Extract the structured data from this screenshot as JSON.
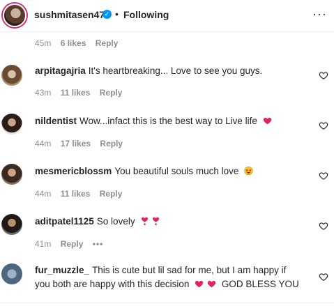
{
  "header": {
    "username": "sushmitasen47",
    "separator": "•",
    "follow_status": "Following",
    "more_label": "···"
  },
  "top_meta": {
    "time": "45m",
    "likes": "6 likes",
    "reply": "Reply"
  },
  "comments": [
    {
      "user": "arpitagajria",
      "text": "It's heartbreaking... Love to see you guys.",
      "time": "43m",
      "likes": "11 likes",
      "reply": "Reply",
      "emoji": []
    },
    {
      "user": "nildentist",
      "text": "Wow...infact this is the best way to Live life",
      "time": "44m",
      "likes": "17 likes",
      "reply": "Reply",
      "emoji": [
        "red-heart-icon"
      ]
    },
    {
      "user": "mesmericblossm",
      "text": "You beautiful souls much love",
      "time": "44m",
      "likes": "11 likes",
      "reply": "Reply",
      "emoji": [
        "star-struck-icon"
      ]
    },
    {
      "user": "aditpatel1125",
      "text": "So lovely",
      "time": "41m",
      "likes": "",
      "reply": "Reply",
      "more": "•••",
      "emoji": [
        "heart-exclamation-icon",
        "heart-exclamation-icon"
      ]
    },
    {
      "user": "fur_muzzle_",
      "text": "This is cute but lil sad for me, but I am happy if",
      "text2": "you both are happy with this decision",
      "text3": "GOD BLESS YOU",
      "emoji": [
        "red-heart-icon",
        "red-heart-icon"
      ]
    }
  ],
  "colors": {
    "heart": "#e0245e",
    "verified": "#0095f6",
    "muted": "#8e8e8e"
  }
}
